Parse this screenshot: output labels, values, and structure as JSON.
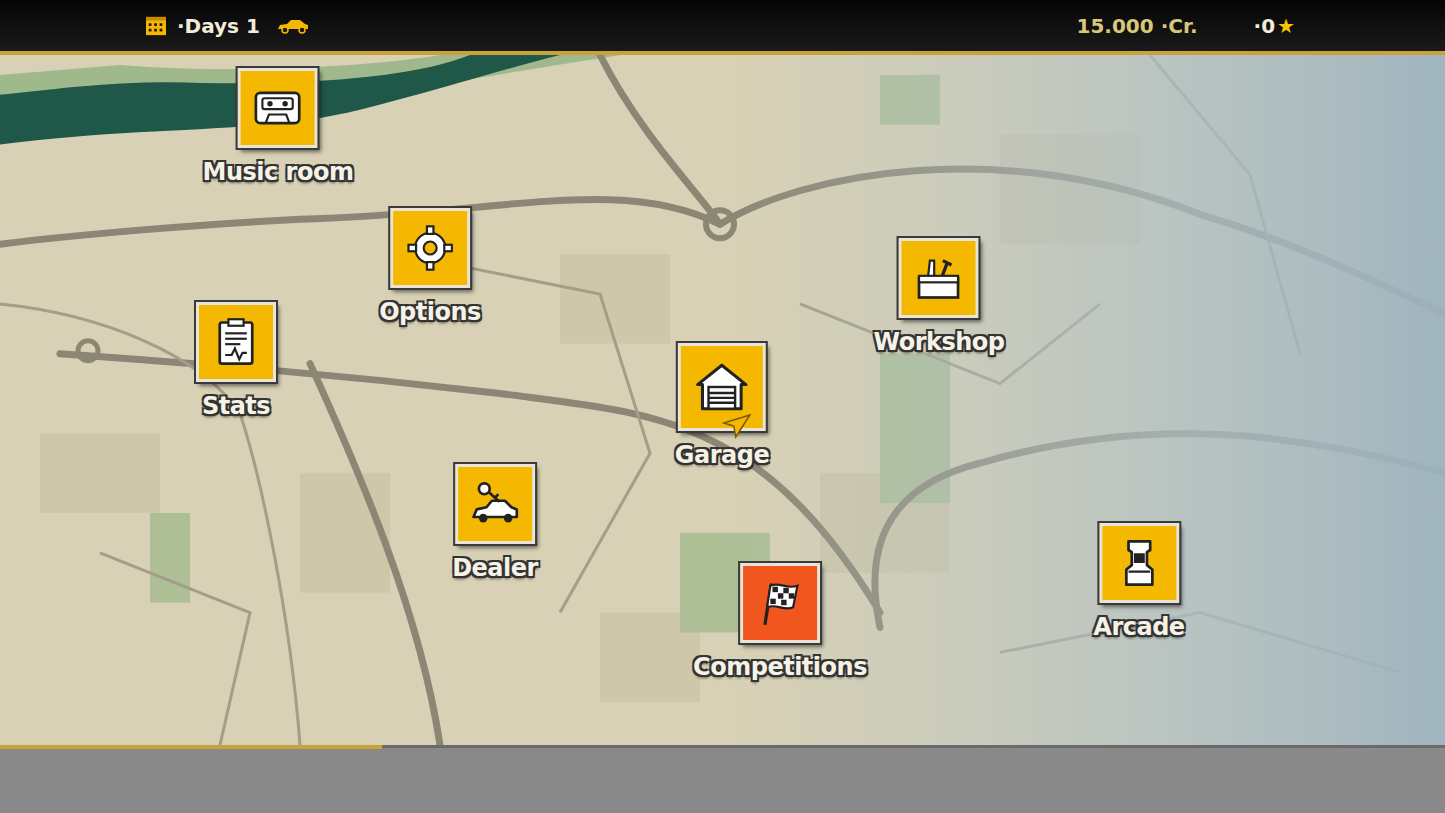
{
  "top_bar": {
    "days": "·Days 1",
    "credits": "15.000 ·Cr.",
    "stars": "·0",
    "star_icon": "★"
  },
  "menu": [
    {
      "label": "Music room",
      "kind": "cassette",
      "color": "#f5b800",
      "selected": false
    },
    {
      "label": "Options",
      "kind": "gear",
      "color": "#f5b800",
      "selected": false
    },
    {
      "label": "Stats",
      "kind": "clipboard",
      "color": "#f5b800",
      "selected": false
    },
    {
      "label": "Garage",
      "kind": "garage",
      "color": "#f5b800",
      "selected": true
    },
    {
      "label": "Workshop",
      "kind": "toolbox",
      "color": "#f5b800",
      "selected": false
    },
    {
      "label": "Dealer",
      "kind": "dealer",
      "color": "#f5b800",
      "selected": false
    },
    {
      "label": "Competitions",
      "kind": "flag",
      "color": "#f0561e",
      "selected": false
    },
    {
      "label": "Arcade",
      "kind": "arcade",
      "color": "#f5b800",
      "selected": false
    }
  ]
}
